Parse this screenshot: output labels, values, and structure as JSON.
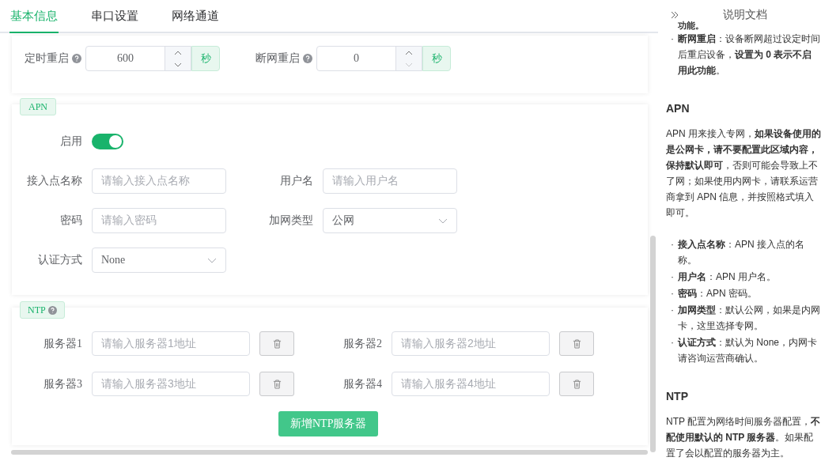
{
  "tabs": [
    {
      "label": "基本信息",
      "selected": true
    },
    {
      "label": "串口设置",
      "selected": false
    },
    {
      "label": "网络通道",
      "selected": false
    }
  ],
  "restart": [
    {
      "label": "定时重启",
      "help": true,
      "value": "600",
      "unit": "秒",
      "decrement_disabled": false
    },
    {
      "label": "断网重启",
      "help": true,
      "value": "0",
      "unit": "秒",
      "decrement_disabled": true
    }
  ],
  "apn": {
    "tag": "APN",
    "enable": {
      "label": "启用",
      "on": true
    },
    "fields": [
      {
        "label": "接入点名称",
        "kind": "input",
        "placeholder": "请输入接入点名称"
      },
      {
        "label": "用户名",
        "kind": "input",
        "placeholder": "请输入用户名"
      },
      {
        "label": "密码",
        "kind": "input",
        "placeholder": "请输入密码"
      },
      {
        "label": "加网类型",
        "kind": "select",
        "value": "公网"
      },
      {
        "label": "认证方式",
        "kind": "select",
        "value": "None"
      }
    ]
  },
  "ntp": {
    "tag": "NTP",
    "help": true,
    "servers": [
      {
        "label": "服务器1",
        "placeholder": "请输入服务器1地址"
      },
      {
        "label": "服务器2",
        "placeholder": "请输入服务器2地址"
      },
      {
        "label": "服务器3",
        "placeholder": "请输入服务器3地址"
      },
      {
        "label": "服务器4",
        "placeholder": "请输入服务器4地址"
      }
    ],
    "add_button": "新增NTP服务器"
  },
  "doc": {
    "title": "说明文档",
    "blocks": [
      {
        "kind": "fragment",
        "text": "功能。"
      },
      {
        "kind": "bullet",
        "marker": "·",
        "text": "**断网重启**：设备断网超过设定时间后重启设备，**设置为 0 表示不启用此功能**。"
      },
      {
        "kind": "heading",
        "text": "APN"
      },
      {
        "kind": "paragraph",
        "text": "APN 用来接入专网，**如果设备使用的是公网卡，请不要配置此区域内容，保持默认即可**，否则可能会导致上不了网；如果使用内网卡，请联系运营商拿到 APN 信息，并按照格式填入即可。"
      },
      {
        "kind": "bullet",
        "marker": "·",
        "text": "**接入点名称**：APN 接入点的名称。"
      },
      {
        "kind": "bullet",
        "marker": "·",
        "text": "**用户名**：APN 用户名。"
      },
      {
        "kind": "bullet",
        "marker": "·",
        "text": "**密码**：APN 密码。"
      },
      {
        "kind": "bullet",
        "marker": "·",
        "text": "**加网类型**：默认公网，如果是内网卡，这里选择专网。"
      },
      {
        "kind": "bullet",
        "marker": "·",
        "text": "**认证方式**：默认为 None，内网卡请咨询运营商确认。"
      },
      {
        "kind": "heading",
        "text": "NTP"
      },
      {
        "kind": "paragraph",
        "text": "NTP 配置为网络时间服务器配置，**不配使用默认的 NTP 服务器**。如果配置了会以配置的服务器为主。"
      }
    ]
  }
}
